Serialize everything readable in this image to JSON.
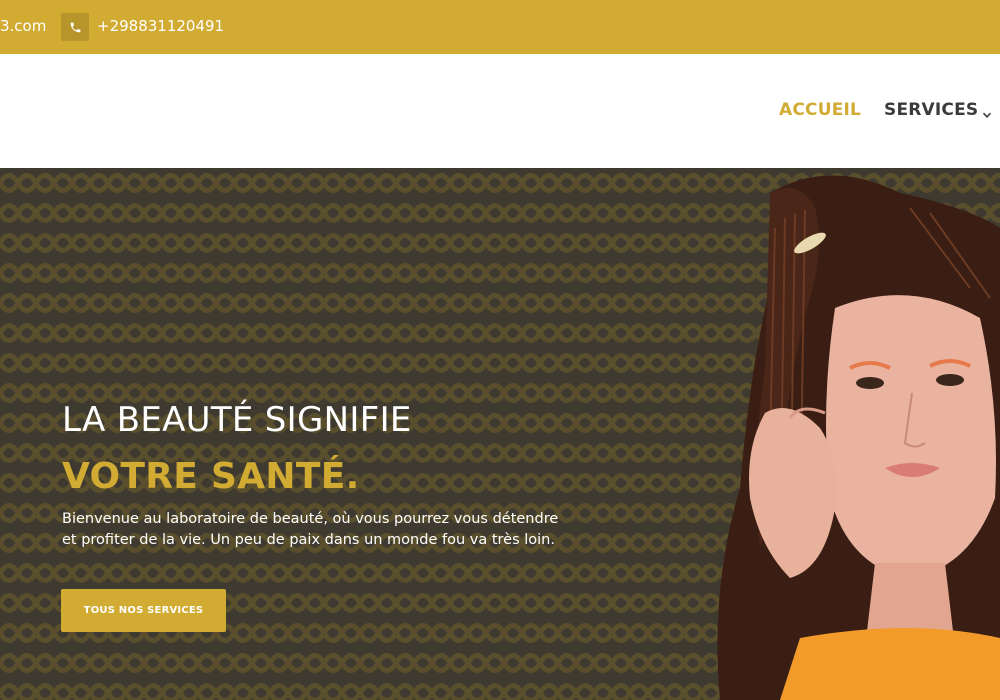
{
  "topbar": {
    "email": "3.com",
    "phone": "+298831120491",
    "phone_icon": "phone-icon"
  },
  "nav": {
    "items": [
      {
        "label": "ACCUEIL",
        "active": true
      },
      {
        "label": "SERVICES",
        "active": false,
        "icon": "chevron-down-icon"
      }
    ]
  },
  "hero": {
    "headline_line1": "LA BEAUTÉ SIGNIFIE",
    "headline_line2": "VOTRE SANTÉ.",
    "intro": "Bienvenue au laboratoire de beauté, où vous pourrez vous détendre et profiter de la vie. Un peu de paix dans un monde fou va très loin.",
    "cta_label": "TOUS NOS SERVICES"
  },
  "colors": {
    "accent": "#d2ab33",
    "hero_bg": "#3f3a30",
    "nav_text": "#3d3b3a",
    "white": "#ffffff"
  }
}
